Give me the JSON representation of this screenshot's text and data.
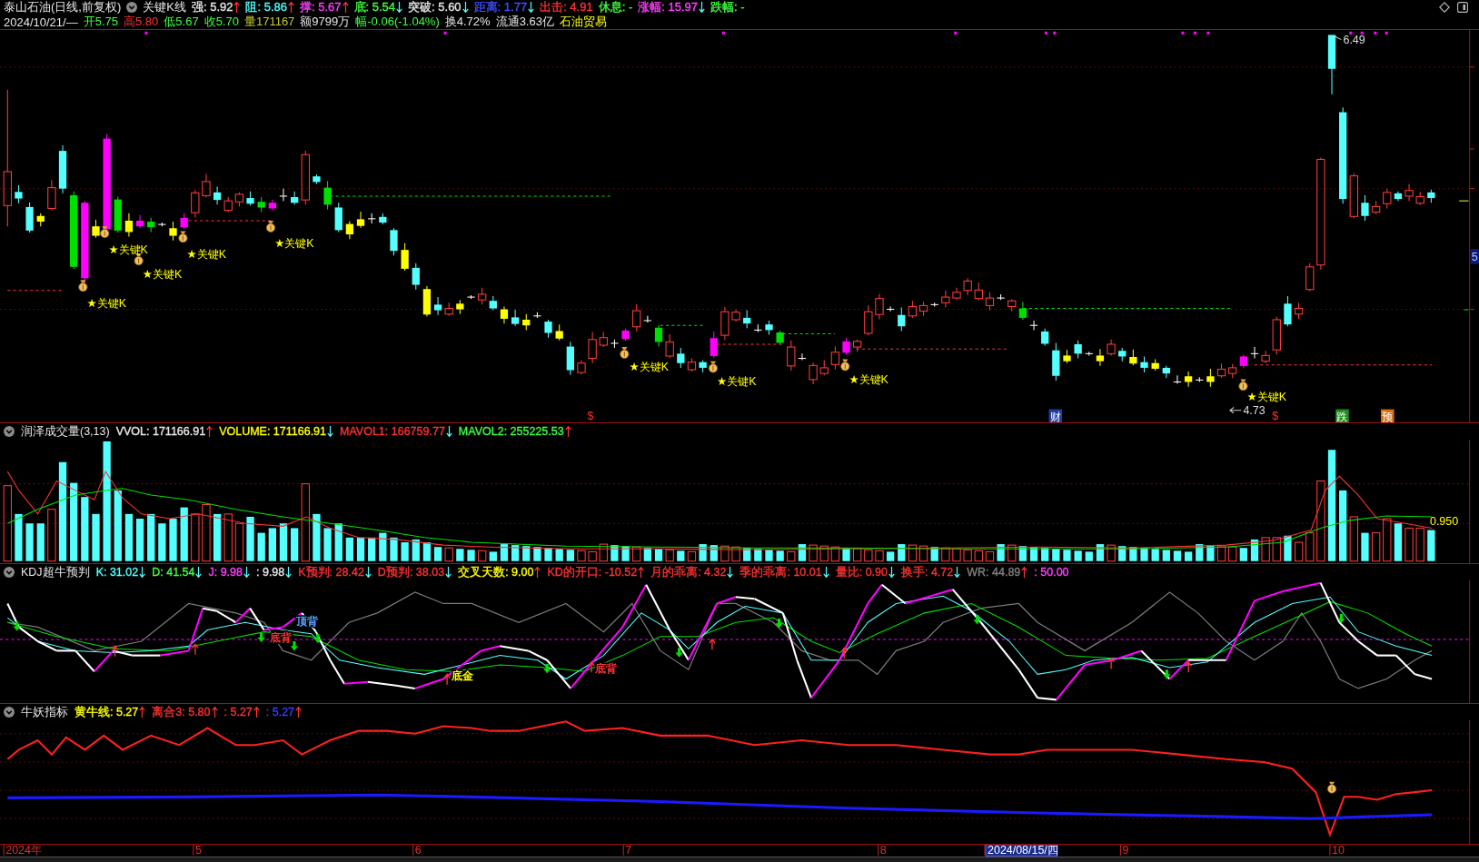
{
  "header": {
    "title": "泰山石油(日线,前复权)",
    "study": "关键K线",
    "indicators": [
      {
        "label": "强: 5.92",
        "color": "#e6e6e6",
        "rising": true
      },
      {
        "label": "阻: 5.86",
        "color": "#54ffff",
        "rising": true
      },
      {
        "label": "撑: 5.67",
        "color": "#ff40ff",
        "rising": true
      },
      {
        "label": "底: 5.54",
        "color": "#40ff40",
        "rising": false
      },
      {
        "label": "突破: 5.60",
        "color": "#e6e6e6",
        "rising": false
      },
      {
        "label": "距离: 1.77",
        "color": "#3c50ff",
        "rising": false
      },
      {
        "label": "出击: 4.91",
        "color": "#ff3232"
      },
      {
        "label": "休息: -",
        "color": "#40ff40"
      },
      {
        "label": "涨幅: 15.97",
        "color": "#ff40ff",
        "rising": false
      },
      {
        "label": "跌幅: -",
        "color": "#40ff40"
      }
    ],
    "quote": [
      {
        "text": "2024/10/21/—",
        "color": "#e6e6e6"
      },
      {
        "text": "开5.75",
        "color": "#40ff40"
      },
      {
        "text": "高5.80",
        "color": "#ff3232"
      },
      {
        "text": "低5.67",
        "color": "#40ff40"
      },
      {
        "text": "收5.70",
        "color": "#40ff40"
      },
      {
        "text": "量171167",
        "color": "#c8c832"
      },
      {
        "text": "额9799万",
        "color": "#e6e6e6"
      },
      {
        "text": "幅-0.06(-1.04%)",
        "color": "#40ff40"
      },
      {
        "text": "换4.72%",
        "color": "#e6e6e6"
      },
      {
        "text": "流通3.63亿",
        "color": "#e6e6e6"
      },
      {
        "text": "石油贸易",
        "color": "#ffff00"
      }
    ]
  },
  "price_chart": {
    "signal_labels": [
      "★关键K",
      "★关键K",
      "★关键K",
      "★关键K",
      "★关键K",
      "★关键K",
      "★关键K",
      "★关键K",
      "★关键K"
    ],
    "event_tags": [
      {
        "text": "$",
        "kind": "plain",
        "color": "#ff3030"
      },
      {
        "text": "财",
        "kind": "boxed",
        "color": "#1f3f9f"
      },
      {
        "text": "$",
        "kind": "plain",
        "color": "#ff3030"
      },
      {
        "text": "跌",
        "kind": "boxed",
        "color": "#1f8f1f"
      },
      {
        "text": "预",
        "kind": "boxed",
        "color": "#d07010"
      }
    ],
    "high_label": "6.49",
    "low_label": "4.73",
    "axis_label": "5"
  },
  "volume_panel": {
    "title": "润泽成交量(3,13)",
    "indicators": [
      {
        "label": "VVOL: 171166.91",
        "color": "#e6e6e6",
        "rising": true
      },
      {
        "label": "VOLUME: 171166.91",
        "color": "#ffff00",
        "rising": false
      },
      {
        "label": "MAVOL1: 166759.77",
        "color": "#ff3232",
        "rising": false
      },
      {
        "label": "MAVOL2: 255225.53",
        "color": "#40ff40",
        "rising": true
      }
    ],
    "end_label": "0.950"
  },
  "kdj_panel": {
    "title": "KDJ超牛预判",
    "indicators": [
      {
        "label": "K: 31.02",
        "color": "#54ffff",
        "rising": false
      },
      {
        "label": "D: 41.54",
        "color": "#40ff40",
        "rising": false
      },
      {
        "label": "J: 9.98",
        "color": "#ff40ff",
        "rising": false
      },
      {
        "label": ": 9.98",
        "color": "#e6e6e6",
        "rising": false
      },
      {
        "label": "K预判: 28.42",
        "color": "#ff3232",
        "rising": false
      },
      {
        "label": "D预判: 38.03",
        "color": "#ff3232",
        "rising": false
      },
      {
        "label": "交叉天数: 9.00",
        "color": "#ffff00",
        "rising": true
      },
      {
        "label": "KD的开口: -10.52",
        "color": "#ff3232",
        "rising": true
      },
      {
        "label": "月的乖离: 4.32",
        "color": "#ff3232",
        "rising": false
      },
      {
        "label": "季的乖离: 10.01",
        "color": "#ff3232",
        "rising": false
      },
      {
        "label": "量比: 0.90",
        "color": "#ff3232",
        "rising": false
      },
      {
        "label": "换手: 4.72",
        "color": "#ff3232",
        "rising": false
      },
      {
        "label": "WR: 44.89",
        "color": "#808080",
        "rising": true
      },
      {
        "label": ": 50.00",
        "color": "#ff40ff"
      }
    ],
    "signals": [
      {
        "text": "底背",
        "color": "#ff3232"
      },
      {
        "text": "顶背",
        "color": "#54a0ff"
      },
      {
        "text": "底金",
        "color": "#ffff00"
      },
      {
        "text": "底背",
        "color": "#ff3232"
      }
    ]
  },
  "niu_panel": {
    "title": "牛妖指标",
    "indicators": [
      {
        "label": "黄牛线: 5.27",
        "color": "#ffff00",
        "rising": true
      },
      {
        "label": "离合3: 5.80",
        "color": "#ff3232",
        "rising": true
      },
      {
        "label": ": 5.27",
        "color": "#ff3232",
        "rising": true
      },
      {
        "label": ": 5.27",
        "color": "#3c3cff",
        "rising": true
      }
    ]
  },
  "date_axis": {
    "labels": [
      {
        "text": "2024年",
        "highlighted": false
      },
      {
        "text": "5",
        "highlighted": false
      },
      {
        "text": "6",
        "highlighted": false
      },
      {
        "text": "7",
        "highlighted": false
      },
      {
        "text": "8",
        "highlighted": false
      },
      {
        "text": "2024/08/15/四",
        "highlighted": true
      },
      {
        "text": "9",
        "highlighted": false
      },
      {
        "text": "10",
        "highlighted": false
      }
    ]
  }
}
